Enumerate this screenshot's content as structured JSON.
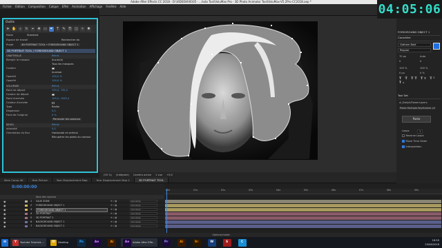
{
  "window": {
    "title": "Adobe After Effects CC 2018 - D:\\VIDEOHIVE\\05 - ...hoto Tool\\VoluMax Pro - 3D Photo Animator Tool\\VoluMax-V5.2Pro-CC2018.aep *",
    "controls": [
      "—",
      "☐",
      "✕"
    ]
  },
  "clock": "04:05:06",
  "menu": [
    "Fichier",
    "Édition",
    "Composition",
    "Calque",
    "Effet",
    "Animation",
    "Affichage",
    "Fenêtre",
    "Aide"
  ],
  "left_panel": {
    "title": "Outils",
    "rows": [
      {
        "label": "Mode",
        "value": "Standard"
      },
      {
        "label": "Espace de travail",
        "value": "Rechercher da"
      },
      {
        "label": "Projet",
        "value": "3D PORTRAIT TOOL • FOREGROUND OBJECT 1"
      }
    ],
    "properties_header": "3D PORTRAIT TOOL / FOREGROUND OBJECT 1",
    "properties": [
      {
        "label": "CRAFTMILLE",
        "value": "Réinit.",
        "sel": true
      },
      {
        "label": "Remplir le masque",
        "value": "Aucun(e)"
      },
      {
        "label": "",
        "value": "Tous les masques"
      },
      {
        "label": "Couleur",
        "value": ""
      },
      {
        "label": "",
        "value": "Inverser"
      },
      {
        "label": "Opacité",
        "value": "100,0 %"
      },
      {
        "label": "Opacité",
        "value": "100,0 %"
      },
      {
        "label": "VOLUMIZE",
        "value": "Réinit.",
        "sel": true
      },
      {
        "label": "Point de départ",
        "value": "155,0, 735,0"
      },
      {
        "label": "Couleur de départ",
        "value": ""
      },
      {
        "label": "Point d'arrivée",
        "value": "155,0, 1005,0"
      },
      {
        "label": "Couleur d'arrivée",
        "value": ""
      },
      {
        "label": "Type",
        "value": "Radial"
      },
      {
        "label": "Dispersion",
        "value": "0,0"
      },
      {
        "label": "Fond de l'original",
        "value": "0 %"
      },
      {
        "label": "",
        "value": "Permuter les couleurs"
      },
      {
        "label": "BEVEL",
        "value": "Réinit.",
        "sel": true
      },
      {
        "label": "Intensité",
        "value": "0,0"
      },
      {
        "label": "Orientation du flou",
        "value": "Horizontal et vertical"
      },
      {
        "label": "",
        "value": "Récupérer les pixels du contour"
      }
    ]
  },
  "composition": {
    "footer": [
      "(50 %)",
      "(Intégrale)",
      "Caméra active",
      "1 vue",
      "+0,0"
    ]
  },
  "right_panel": {
    "header1": "FOREGROUND OBJECT 1",
    "header2": "Caractère",
    "font_label": "Gotham Bold",
    "style_label": "Regular",
    "metrics": [
      "70 px",
      "Auto",
      "0",
      "0",
      "100 %",
      "100 %",
      "0 px",
      "0 %"
    ],
    "tools_header": "Tool Set",
    "tools_item": "xl_Daily&FlowerLayers",
    "tools_item2": "Paste Multiple Keyframes v2",
    "paste_button": "Paste",
    "options": [
      {
        "label": "Loops",
        "value": "1"
      },
      {
        "label": "Reverse Loops",
        "checked": false
      },
      {
        "label": "Move Time Slider",
        "checked": true
      },
      {
        "label": "Interpolation",
        "checked": true
      }
    ]
  },
  "timeline": {
    "tabs": [
      "Main Comp 4K",
      "Your Picture",
      "Your Displacement Map",
      "Your Displacement Map 2",
      "3D PORTRAIT TOOL"
    ],
    "active_tab": "3D PORTRAIT TOOL",
    "timecode": "0:00:00:00",
    "column_header": "Nom des sources",
    "layers": [
      {
        "num": "1",
        "name": "GLUE ZONE",
        "color": "#b8b2a0",
        "selected": false,
        "parent": "Aucun(e)"
      },
      {
        "num": "2",
        "name": "FOREGROUND OBJECT 1",
        "color": "#d6b85a",
        "selected": false,
        "parent": "Aucun(e)"
      },
      {
        "num": "3",
        "name": "FOREGROUND OBJECT 1",
        "color": "#d6b85a",
        "selected": true,
        "parent": "Aucun(e)"
      },
      {
        "num": "4",
        "name": "3D PORTRAIT",
        "color": "#a86f82",
        "selected": false,
        "parent": "Aucun(e)"
      },
      {
        "num": "5",
        "name": "3D PORTRAIT 1",
        "color": "#a86f82",
        "selected": false,
        "parent": "Aucun(e)"
      },
      {
        "num": "6",
        "name": "BACKGROUND OBJECT 1",
        "color": "#6d72a8",
        "selected": false,
        "parent": "Aucun(e)"
      },
      {
        "num": "7",
        "name": "BACKGROUND OBJECT 2",
        "color": "#6d72a8",
        "selected": false,
        "parent": "Aucun(e)"
      }
    ],
    "bar_colors": [
      "#8a8473",
      "#a89a5f",
      "#a89a5f",
      "#8a5b69",
      "#8a5b69",
      "#5a5f8a",
      "#5a5f8a"
    ],
    "ruler": [
      "00s",
      "01s",
      "02s",
      "03s",
      "04s",
      "05s",
      "06s",
      "07s",
      "08s",
      "09s"
    ],
    "footer": "Options/modes"
  },
  "taskbar": {
    "items": [
      {
        "label": "Youtube Tutorials ...",
        "icon": "Y",
        "color": "#c9302c"
      },
      {
        "label": "Desktop",
        "icon": "D",
        "color": "#e0a800"
      }
    ],
    "apps": [
      {
        "icon": "Ps",
        "color": "#0f2a45",
        "fg": "#31a8ff"
      },
      {
        "icon": "Ae",
        "color": "#1f0740",
        "fg": "#d291ff"
      },
      {
        "icon": "Ai",
        "color": "#3a1a00",
        "fg": "#ff9a00"
      },
      {
        "icon": "Ae",
        "color": "#1f0740",
        "fg": "#d291ff",
        "label": "Adobe After Effe..."
      },
      {
        "icon": "Pr",
        "color": "#1c0a3d",
        "fg": "#9999ff"
      },
      {
        "icon": "Ai",
        "color": "#3a1a00",
        "fg": "#ff9a00"
      },
      {
        "icon": "Br",
        "color": "#2c1a00",
        "fg": "#e37b00"
      },
      {
        "icon": "W",
        "color": "#163e7a",
        "fg": "#ffffff"
      },
      {
        "icon": "S",
        "color": "#a01c1c",
        "fg": "#ffffff"
      },
      {
        "icon": "C",
        "color": "#1a8fd6",
        "fg": "#ffffff"
      }
    ],
    "time": "18:50",
    "date": "29/06/2018"
  }
}
